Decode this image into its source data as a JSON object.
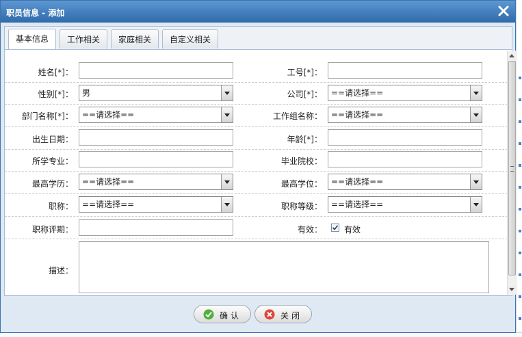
{
  "dialog": {
    "title": "职员信息 - 添加"
  },
  "tabs": [
    {
      "label": "基本信息",
      "active": true
    },
    {
      "label": "工作相关"
    },
    {
      "label": "家庭相关"
    },
    {
      "label": "自定义相关"
    }
  ],
  "form": {
    "name_label": "姓名[*]：",
    "name_value": "",
    "empno_label": "工号[*]：",
    "empno_value": "",
    "gender_label": "性别[*]：",
    "gender_value": "男",
    "company_label": "公司[*]：",
    "company_value": "==请选择==",
    "dept_label": "部门名称[*]：",
    "dept_value": "==请选择==",
    "workgroup_label": "工作组名称：",
    "workgroup_value": "==请选择==",
    "birth_label": "出生日期：",
    "birth_value": "",
    "age_label": "年龄[*]：",
    "age_value": "",
    "major_label": "所学专业：",
    "major_value": "",
    "school_label": "毕业院校：",
    "school_value": "",
    "education_label": "最高学历：",
    "education_value": "==请选择==",
    "degree_label": "最高学位：",
    "degree_value": "==请选择==",
    "title_label": "职称：",
    "title_value": "==请选择==",
    "title_grade_label": "职称等级：",
    "title_grade_value": "==请选择==",
    "title_date_label": "职称评期：",
    "title_date_value": "",
    "valid_label": "有效：",
    "valid_checkbox_label": "有效",
    "valid_checked": true,
    "desc_label": "描述：",
    "desc_value": ""
  },
  "buttons": {
    "confirm": "确认",
    "close": "关闭"
  },
  "colors": {
    "titlebar": "#2f6aaa",
    "confirm_icon": "#4fb03a",
    "close_icon": "#e0453a"
  }
}
